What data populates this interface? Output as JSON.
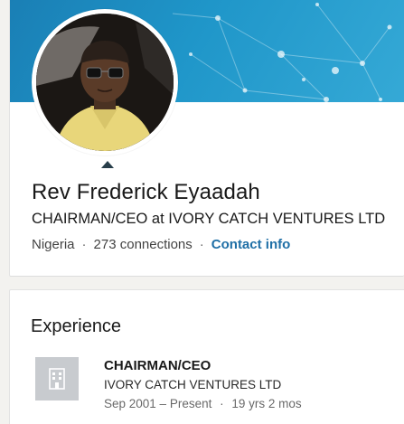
{
  "profile": {
    "name": "Rev Frederick Eyaadah",
    "headline": "CHAIRMAN/CEO at IVORY CATCH VENTURES LTD",
    "location": "Nigeria",
    "separator": "·",
    "connections": "273 connections",
    "contact_link": "Contact info"
  },
  "experience": {
    "section_title": "Experience",
    "items": [
      {
        "title": "CHAIRMAN/CEO",
        "company": "IVORY CATCH VENTURES LTD",
        "date_range": "Sep 2001 – Present",
        "duration": "19 yrs 2 mos",
        "logo_icon": "building-icon"
      }
    ]
  },
  "colors": {
    "banner": "#1f96c9",
    "link": "#1f6fa6",
    "logo_placeholder": "#c8cbcf"
  }
}
